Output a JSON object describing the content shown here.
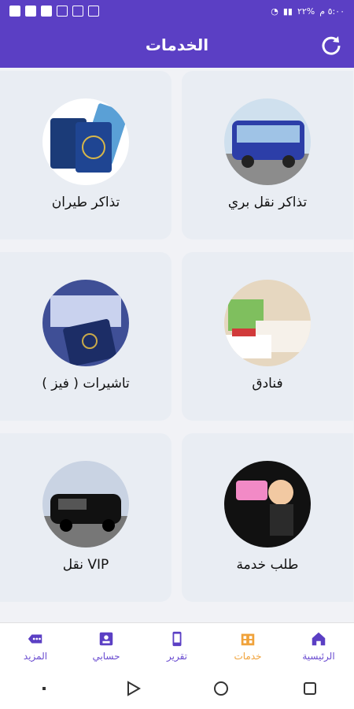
{
  "status": {
    "left_icons": [
      "app-icon",
      "app-icon",
      "app-icon",
      "image-icon",
      "mail-icon",
      "screen-icon"
    ],
    "right_text": "٥:٠٠ م",
    "battery": "%٢٢"
  },
  "header": {
    "title": "الخدمات"
  },
  "services": [
    {
      "label": "تذاكر نقل بري",
      "icon": "bus-image"
    },
    {
      "label": "تذاكر طيران",
      "icon": "passport-tickets-image"
    },
    {
      "label": "فنادق",
      "icon": "hotel-room-image"
    },
    {
      "label": "تاشيرات ( فيز )",
      "icon": "visa-passport-image"
    },
    {
      "label": "طلب خدمة",
      "icon": "service-request-image"
    },
    {
      "label": "VIP نقل",
      "icon": "vip-car-image"
    }
  ],
  "bottom_nav": [
    {
      "label": "الرئيسية",
      "icon": "home-icon"
    },
    {
      "label": "خدمات",
      "icon": "services-icon",
      "active": true
    },
    {
      "label": "تقرير",
      "icon": "report-icon"
    },
    {
      "label": "حسابي",
      "icon": "account-icon"
    },
    {
      "label": "المزيد",
      "icon": "more-icon"
    }
  ],
  "colors": {
    "primary": "#5b3fc4",
    "active": "#f0a23a",
    "card": "#e9edf3"
  }
}
